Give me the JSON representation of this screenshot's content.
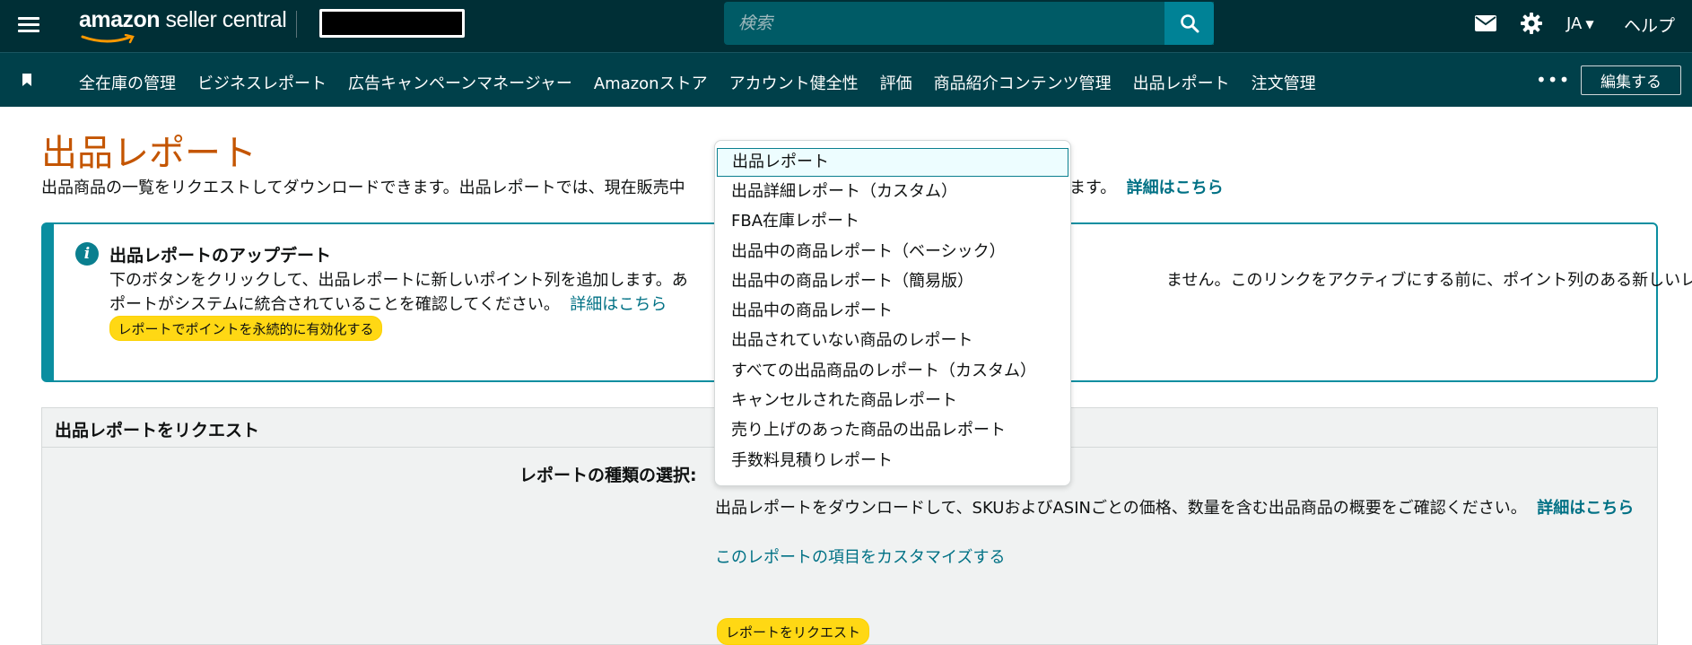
{
  "header": {
    "logo_brand": "amazon",
    "logo_product": " seller central",
    "search_placeholder": "検索",
    "language": "JA",
    "help": "ヘルプ"
  },
  "nav": {
    "items": [
      "全在庫の管理",
      "ビジネスレポート",
      "広告キャンペーンマネージャー",
      "Amazonストア",
      "アカウント健全性",
      "評価",
      "商品紹介コンテンツ管理",
      "出品レポート",
      "注文管理"
    ],
    "more": "•••",
    "edit": "編集する"
  },
  "page": {
    "title": "出品レポート",
    "desc_left": "出品商品の一覧をリクエストしてダウンロードできます。出品レポートでは、現在販売中",
    "desc_right": "ます。",
    "desc_link": "詳細はこちら"
  },
  "info": {
    "title": "出品レポートのアップデート",
    "text1_left": "下のボタンをクリックして、出品レポートに新しいポイント列を追加します。あ",
    "text1_right": "ません。このリンクをアクティブにする前に、ポイント列のある新しいレ",
    "text2": "ポートがシステムに統合されていることを確認してください。",
    "text2_link": "詳細はこちら",
    "button": "レポートでポイントを永続的に有効化する"
  },
  "request": {
    "title": "出品レポートをリクエスト",
    "type_label": "レポートの種類の選択:",
    "description": "出品レポートをダウンロードして、SKUおよびASINごとの価格、数量を含む出品商品の概要をご確認ください。",
    "desc_link": "詳細はこちら",
    "customize_link": "このレポートの項目をカスタマイズする",
    "button": "レポートをリクエスト"
  },
  "dropdown": {
    "selected_index": 0,
    "options": [
      "出品レポート",
      "出品詳細レポート（カスタム）",
      "FBA在庫レポート",
      "出品中の商品レポート（ベーシック）",
      "出品中の商品レポート（簡易版）",
      "出品中の商品レポート",
      "出品されていない商品のレポート",
      "すべての出品商品のレポート（カスタム）",
      "キャンセルされた商品レポート",
      "売り上げのあった商品の出品レポート",
      "手数料見積りレポート"
    ]
  },
  "colors": {
    "topbar": "#002f36",
    "navbar": "#00404a",
    "accent": "#007185",
    "title": "#c45500",
    "button": "#ffd814"
  }
}
